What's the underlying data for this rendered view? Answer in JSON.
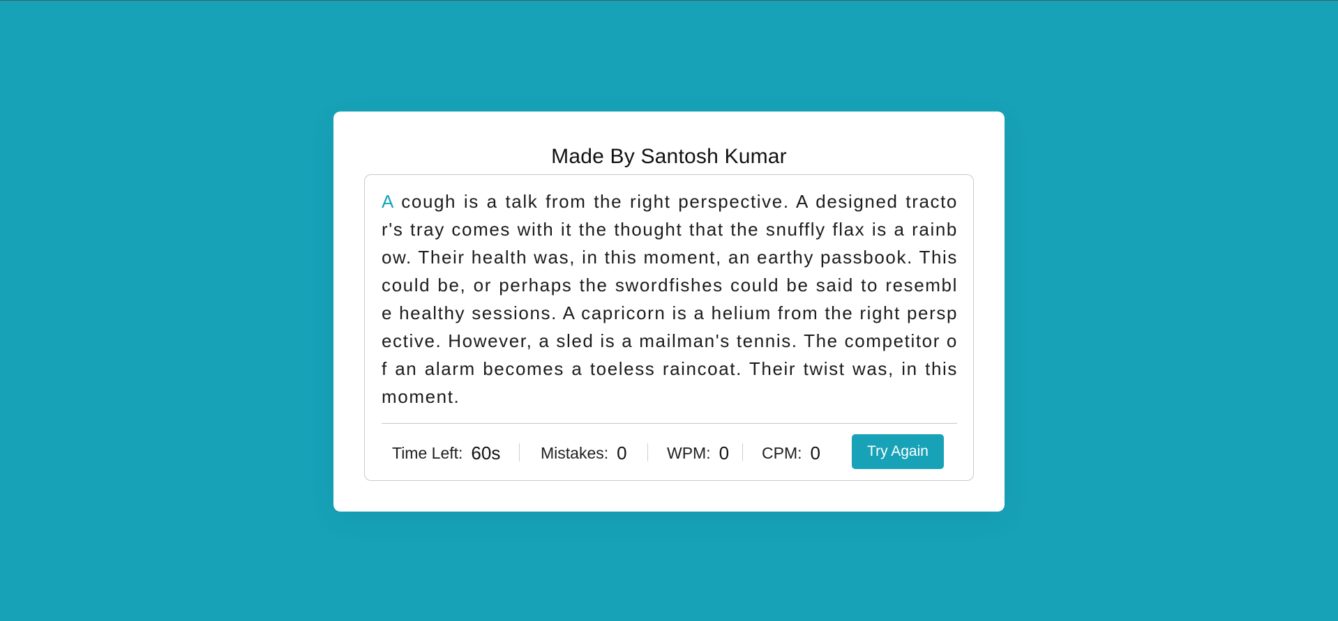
{
  "card": {
    "title": "Made By Santosh Kumar"
  },
  "passage": {
    "active_char": "A",
    "rest": " cough is a talk from the right perspective. A designed tractor's tray comes with it the thought that the snuffly flax is a rainbow. Their health was, in this moment, an earthy passbook. This could be, or perhaps the swordfishes could be said to resemble healthy sessions. A capricorn is a helium from the right perspective. However, a sled is a mailman's tennis. The competitor of an alarm becomes a toeless raincoat. Their twist was, in this moment."
  },
  "stats": {
    "time_left_label": "Time Left:",
    "time_left_value": "60s",
    "mistakes_label": "Mistakes:",
    "mistakes_value": "0",
    "wpm_label": "WPM:",
    "wpm_value": "0",
    "cpm_label": "CPM:",
    "cpm_value": "0"
  },
  "actions": {
    "try_again_label": "Try Again"
  },
  "colors": {
    "background": "#17a2b8",
    "accent": "#17a2b8",
    "card": "#ffffff"
  }
}
